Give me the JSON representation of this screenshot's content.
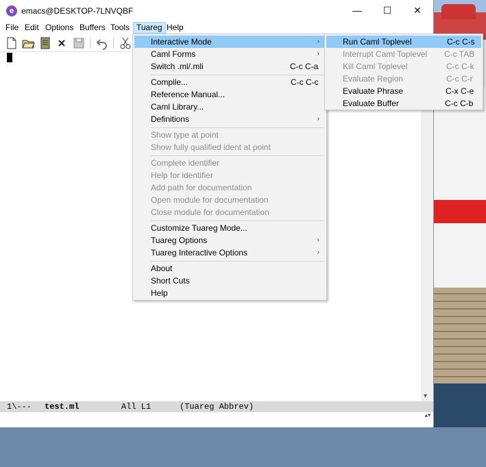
{
  "window": {
    "title": "emacs@DESKTOP-7LNVQBF",
    "min": "—",
    "max": "☐",
    "close": "✕",
    "app_icon": "e"
  },
  "menubar": [
    "File",
    "Edit",
    "Options",
    "Buffers",
    "Tools",
    "Tuareg",
    "Help"
  ],
  "modeline": {
    "status": "1\\---",
    "buffer": "test.ml",
    "position": "All L1",
    "modes": "(Tuareg Abbrev)"
  },
  "tuareg_menu": [
    {
      "label": "Interactive Mode",
      "shortcut": "",
      "submenu": true,
      "disabled": false,
      "selected": true
    },
    {
      "label": "Caml Forms",
      "shortcut": "",
      "submenu": true,
      "disabled": false
    },
    {
      "label": "Switch .ml/.mli",
      "shortcut": "C-c C-a",
      "submenu": false,
      "disabled": false
    },
    {
      "label": "Compile...",
      "shortcut": "C-c C-c",
      "submenu": false,
      "disabled": false
    },
    {
      "label": "Reference Manual...",
      "shortcut": "",
      "submenu": false,
      "disabled": false
    },
    {
      "label": "Caml Library...",
      "shortcut": "",
      "submenu": false,
      "disabled": false
    },
    {
      "label": "Definitions",
      "shortcut": "",
      "submenu": true,
      "disabled": false
    },
    {
      "label": "Show type at point",
      "shortcut": "",
      "submenu": false,
      "disabled": true
    },
    {
      "label": "Show fully qualified ident at point",
      "shortcut": "",
      "submenu": false,
      "disabled": true
    },
    {
      "label": "Complete identifier",
      "shortcut": "",
      "submenu": false,
      "disabled": true
    },
    {
      "label": "Help for identifier",
      "shortcut": "",
      "submenu": false,
      "disabled": true
    },
    {
      "label": "Add path for documentation",
      "shortcut": "",
      "submenu": false,
      "disabled": true
    },
    {
      "label": "Open module for documentation",
      "shortcut": "",
      "submenu": false,
      "disabled": true
    },
    {
      "label": "Close module for documentation",
      "shortcut": "",
      "submenu": false,
      "disabled": true
    },
    {
      "label": "Customize Tuareg Mode...",
      "shortcut": "",
      "submenu": false,
      "disabled": false
    },
    {
      "label": "Tuareg Options",
      "shortcut": "",
      "submenu": true,
      "disabled": false
    },
    {
      "label": "Tuareg Interactive Options",
      "shortcut": "",
      "submenu": true,
      "disabled": false
    },
    {
      "label": "About",
      "shortcut": "",
      "submenu": false,
      "disabled": false
    },
    {
      "label": "Short Cuts",
      "shortcut": "",
      "submenu": false,
      "disabled": false
    },
    {
      "label": "Help",
      "shortcut": "",
      "submenu": false,
      "disabled": false
    }
  ],
  "interactive_submenu": [
    {
      "label": "Run Caml Toplevel",
      "shortcut": "C-c C-s",
      "disabled": false,
      "selected": true
    },
    {
      "label": "Interrupt Caml Toplevel",
      "shortcut": "C-c TAB",
      "disabled": true
    },
    {
      "label": "Kill Caml Toplevel",
      "shortcut": "C-c C-k",
      "disabled": true
    },
    {
      "label": "Evaluate Region",
      "shortcut": "C-c C-r",
      "disabled": true
    },
    {
      "label": "Evaluate Phrase",
      "shortcut": "C-x C-e",
      "disabled": false
    },
    {
      "label": "Evaluate Buffer",
      "shortcut": "C-c C-b",
      "disabled": false
    }
  ],
  "submenu_arrow": "›",
  "scroll": {
    "down": "▾",
    "mini": "▴▾"
  }
}
